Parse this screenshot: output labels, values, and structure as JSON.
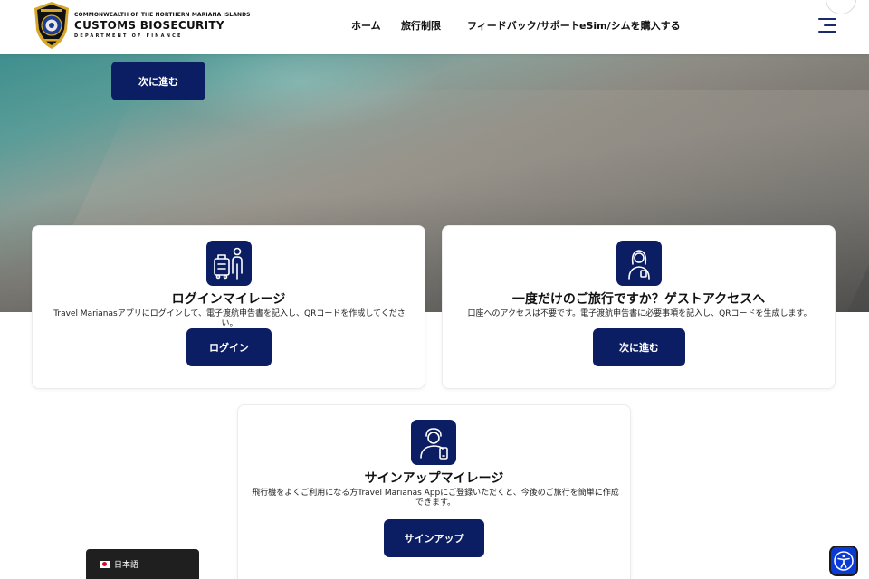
{
  "header": {
    "logo": {
      "line1": "COMMONWEALTH OF THE NORTHERN MARIANA ISLANDS",
      "line2": "CUSTOMS BIOSECURITY",
      "line3": "DEPARTMENT OF FINANCE",
      "badge_icon": "customs-shield-badge-icon"
    },
    "nav": [
      {
        "label": "ホーム"
      },
      {
        "label": "旅行制限"
      },
      {
        "label": "フィードバック/サポート"
      },
      {
        "label": "eSim/シムを購入する"
      }
    ],
    "menu_icon": "hamburger-menu-icon"
  },
  "hero": {
    "button_label": "次に進む"
  },
  "cards": {
    "login": {
      "icon": "luggage-traveler-icon",
      "title": "ログインマイレージ",
      "description": "Travel Marianasアプリにログインして、電子渡航申告書を記入し、QRコードを作成してください。",
      "button_label": "ログイン"
    },
    "guest": {
      "icon": "guest-woman-icon",
      "title": "一度だけのご旅行ですか？ゲストアクセスへ",
      "description": "口座へのアクセスは不要です。電子渡航申告書に必要事項を記入し、QRコードを生成します。",
      "button_label": "次に進む"
    },
    "signup": {
      "icon": "user-phone-icon",
      "title": "サインアップマイレージ",
      "description": "飛行機をよくご利用になる方Travel Marianas Appにご登録いただくと、今後のご旅行を簡単に作成できます。",
      "button_label": "サインアップ"
    }
  },
  "language": {
    "label": "日本語",
    "flag_icon": "japan-flag-icon"
  },
  "accessibility": {
    "icon": "accessibility-person-icon"
  },
  "colors": {
    "primary": "#0b1d63",
    "accessibility": "#0b3bd6",
    "language_bar": "#1f1f1f"
  }
}
